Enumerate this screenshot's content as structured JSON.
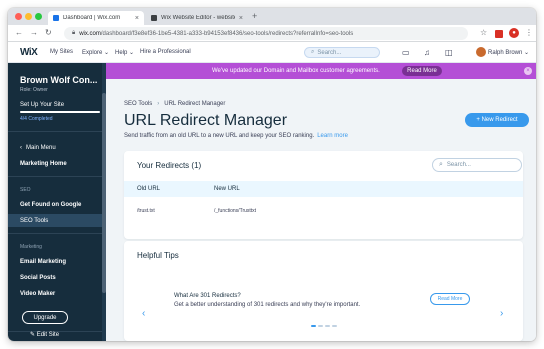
{
  "browser": {
    "tabs": [
      {
        "title": "Dashboard | Wix.com",
        "close": "×"
      },
      {
        "title": "Wix Website Editor - website",
        "close": "×"
      }
    ],
    "new_tab": "+",
    "url_domain": "wix.com",
    "url_path": "/dashboard/f3e8ef36-1be5-4381-a333-b94153ef8436/seo-tools/redirects?referralInfo=seo-tools"
  },
  "wix_bar": {
    "logo": "WiX",
    "menu": [
      "My Sites",
      "Explore ⌄",
      "Help ⌄",
      "Hire a Professional"
    ],
    "search_placeholder": "Search...",
    "user_name": "Ralph Brown ⌄"
  },
  "sidebar": {
    "site_name": "Brown Wolf Con...",
    "role": "Role: Owner",
    "setup_label": "Set Up Your Site",
    "progress_text": "4/4 Completed",
    "progress_fraction": 1.0,
    "main_menu": "Main Menu",
    "marketing_home": "Marketing Home",
    "section_seo": "SEO",
    "get_found": "Get Found on Google",
    "seo_tools": "SEO Tools",
    "section_marketing": "Marketing",
    "email_marketing": "Email Marketing",
    "social_posts": "Social Posts",
    "video_maker": "Video Maker",
    "upgrade": "Upgrade",
    "edit_site": "Edit Site"
  },
  "notice": {
    "text": "We've updated our Domain and Mailbox customer agreements.",
    "button": "Read More",
    "close": "×"
  },
  "page": {
    "breadcrumb": [
      "SEO Tools",
      "URL Redirect Manager"
    ],
    "title": "URL Redirect Manager",
    "subtitle": "Send traffic from an old URL to a new URL and keep your SEO ranking.",
    "learn_more": "Learn more",
    "new_redirect": "+  New Redirect"
  },
  "redirects_card": {
    "title": "Your Redirects (1)",
    "search_placeholder": "Search...",
    "columns": [
      "Old URL",
      "New URL"
    ],
    "rows": [
      {
        "old": "/trust.txt",
        "new": "/_functions/Trusttxt"
      }
    ]
  },
  "tips_card": {
    "title": "Helpful Tips",
    "tip_title": "What Are 301 Redirects?",
    "tip_desc": "Get a better understanding of 301 redirects and why they're important.",
    "read_more": "Read More",
    "prev": "‹",
    "next": "›"
  },
  "colors": {
    "sidebar": "#162d3d",
    "accent": "#3899ec",
    "notice": "#b44fd6"
  }
}
